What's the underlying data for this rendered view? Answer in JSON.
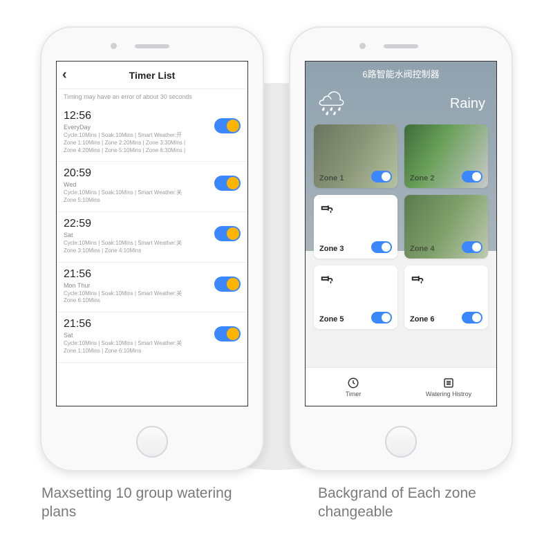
{
  "captions": {
    "left": "Maxsetting 10 group watering plans",
    "right": "Backgrand of Each zone changeable"
  },
  "screenA": {
    "title": "Timer List",
    "note": "Timing may have an error of about 30 seconds",
    "items": [
      {
        "time": "12:56",
        "days": "EveryDay",
        "detail": "Cycle:10Mins | Soak:10Mins | Smart Weather:开\nZone 1:10Mins | Zone 2:20Mins | Zone 3:30Mins |\nZone 4:20Mins | Zone 5:10Mins | Zone 6:30Mins |",
        "on": true
      },
      {
        "time": "20:59",
        "days": "Wed",
        "detail": "Cycle:10Mins | Soak:10Mins | Smart Weather:关\nZone 5:10Mins",
        "on": true
      },
      {
        "time": "22:59",
        "days": "Sat",
        "detail": "Cycle:10Mins | Soak:10Mins | Smart Weather:关\nZone 3:10Mins | Zone 4:10Mins",
        "on": true
      },
      {
        "time": "21:56",
        "days": "Mon Thur",
        "detail": "Cycle:10Mins | Soak:10Mins | Smart Weather:关\nZone 6:10Mins",
        "on": true
      },
      {
        "time": "21:56",
        "days": "Sat",
        "detail": "Cycle:10Mins | Soak:10Mins | Smart Weather:关\nZone 1:10Mins | Zone 6:10Mins",
        "on": true
      }
    ]
  },
  "screenB": {
    "title": "6路智能水阀控制器",
    "weather": "Rainy",
    "zones": [
      {
        "label": "Zone 1",
        "image": true,
        "on": true
      },
      {
        "label": "Zone 2",
        "image": true,
        "on": true
      },
      {
        "label": "Zone 3",
        "image": false,
        "on": true
      },
      {
        "label": "Zone 4",
        "image": true,
        "on": true
      },
      {
        "label": "Zone 5",
        "image": false,
        "on": true
      },
      {
        "label": "Zone 6",
        "image": false,
        "on": true
      }
    ],
    "tabs": {
      "timer": "Timer",
      "history": "Watering Histroy"
    }
  }
}
